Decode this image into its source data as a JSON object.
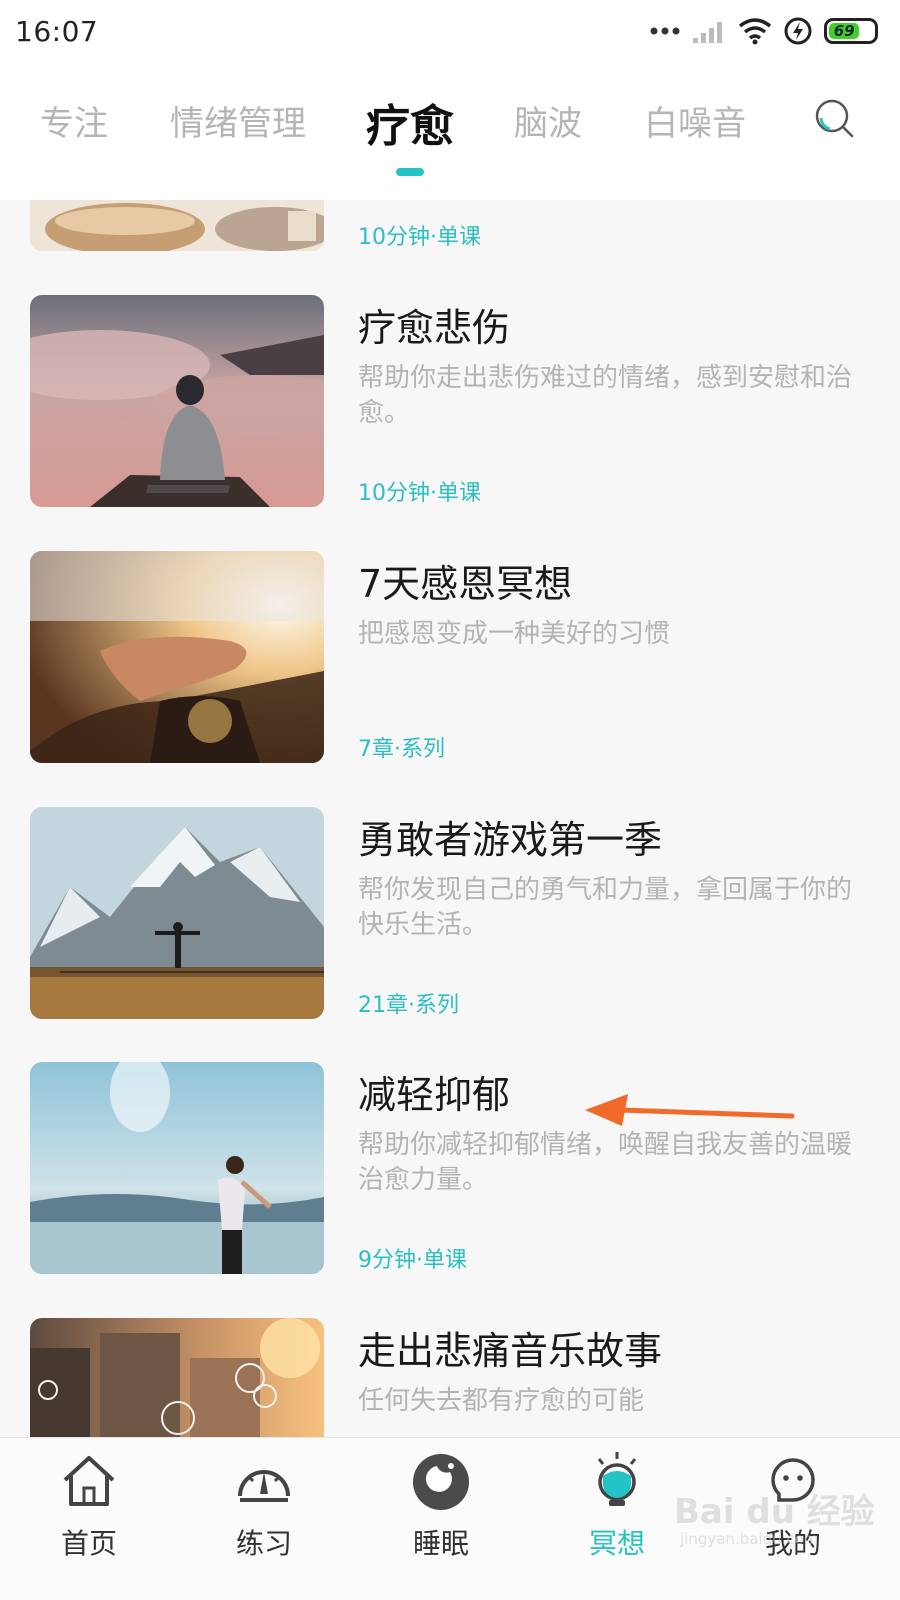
{
  "status_bar": {
    "time": "16:07",
    "battery_level": "69"
  },
  "tabs": [
    {
      "label": "专注",
      "active": false
    },
    {
      "label": "情绪管理",
      "active": false
    },
    {
      "label": "疗愈",
      "active": true
    },
    {
      "label": "脑波",
      "active": false
    },
    {
      "label": "白噪音",
      "active": false
    }
  ],
  "accent_color": "#24c3c6",
  "courses": [
    {
      "title": "",
      "desc": "",
      "meta": "10分钟·单课"
    },
    {
      "title": "疗愈悲伤",
      "desc": "帮助你走出悲伤难过的情绪，感到安慰和治愈。",
      "meta": "10分钟·单课"
    },
    {
      "title": "7天感恩冥想",
      "desc": "把感恩变成一种美好的习惯",
      "meta": "7章·系列"
    },
    {
      "title": "勇敢者游戏第一季",
      "desc": "帮你发现自己的勇气和力量，拿回属于你的快乐生活。",
      "meta": "21章·系列"
    },
    {
      "title": "减轻抑郁",
      "desc": "帮助你减轻抑郁情绪，唤醒自我友善的温暖治愈力量。",
      "meta": "9分钟·单课"
    },
    {
      "title": "走出悲痛音乐故事",
      "desc": "任何失去都有疗愈的可能",
      "meta": ""
    }
  ],
  "bottom_nav": [
    {
      "label": "首页",
      "icon": "home-icon",
      "active": false
    },
    {
      "label": "练习",
      "icon": "gauge-icon",
      "active": false
    },
    {
      "label": "睡眠",
      "icon": "moon-icon",
      "active": false
    },
    {
      "label": "冥想",
      "icon": "meditation-bulb-icon",
      "active": true
    },
    {
      "label": "我的",
      "icon": "smiley-icon",
      "active": false
    }
  ],
  "watermark": {
    "logo": "Bai du 经验",
    "url": "jingyan.baidu.com"
  }
}
